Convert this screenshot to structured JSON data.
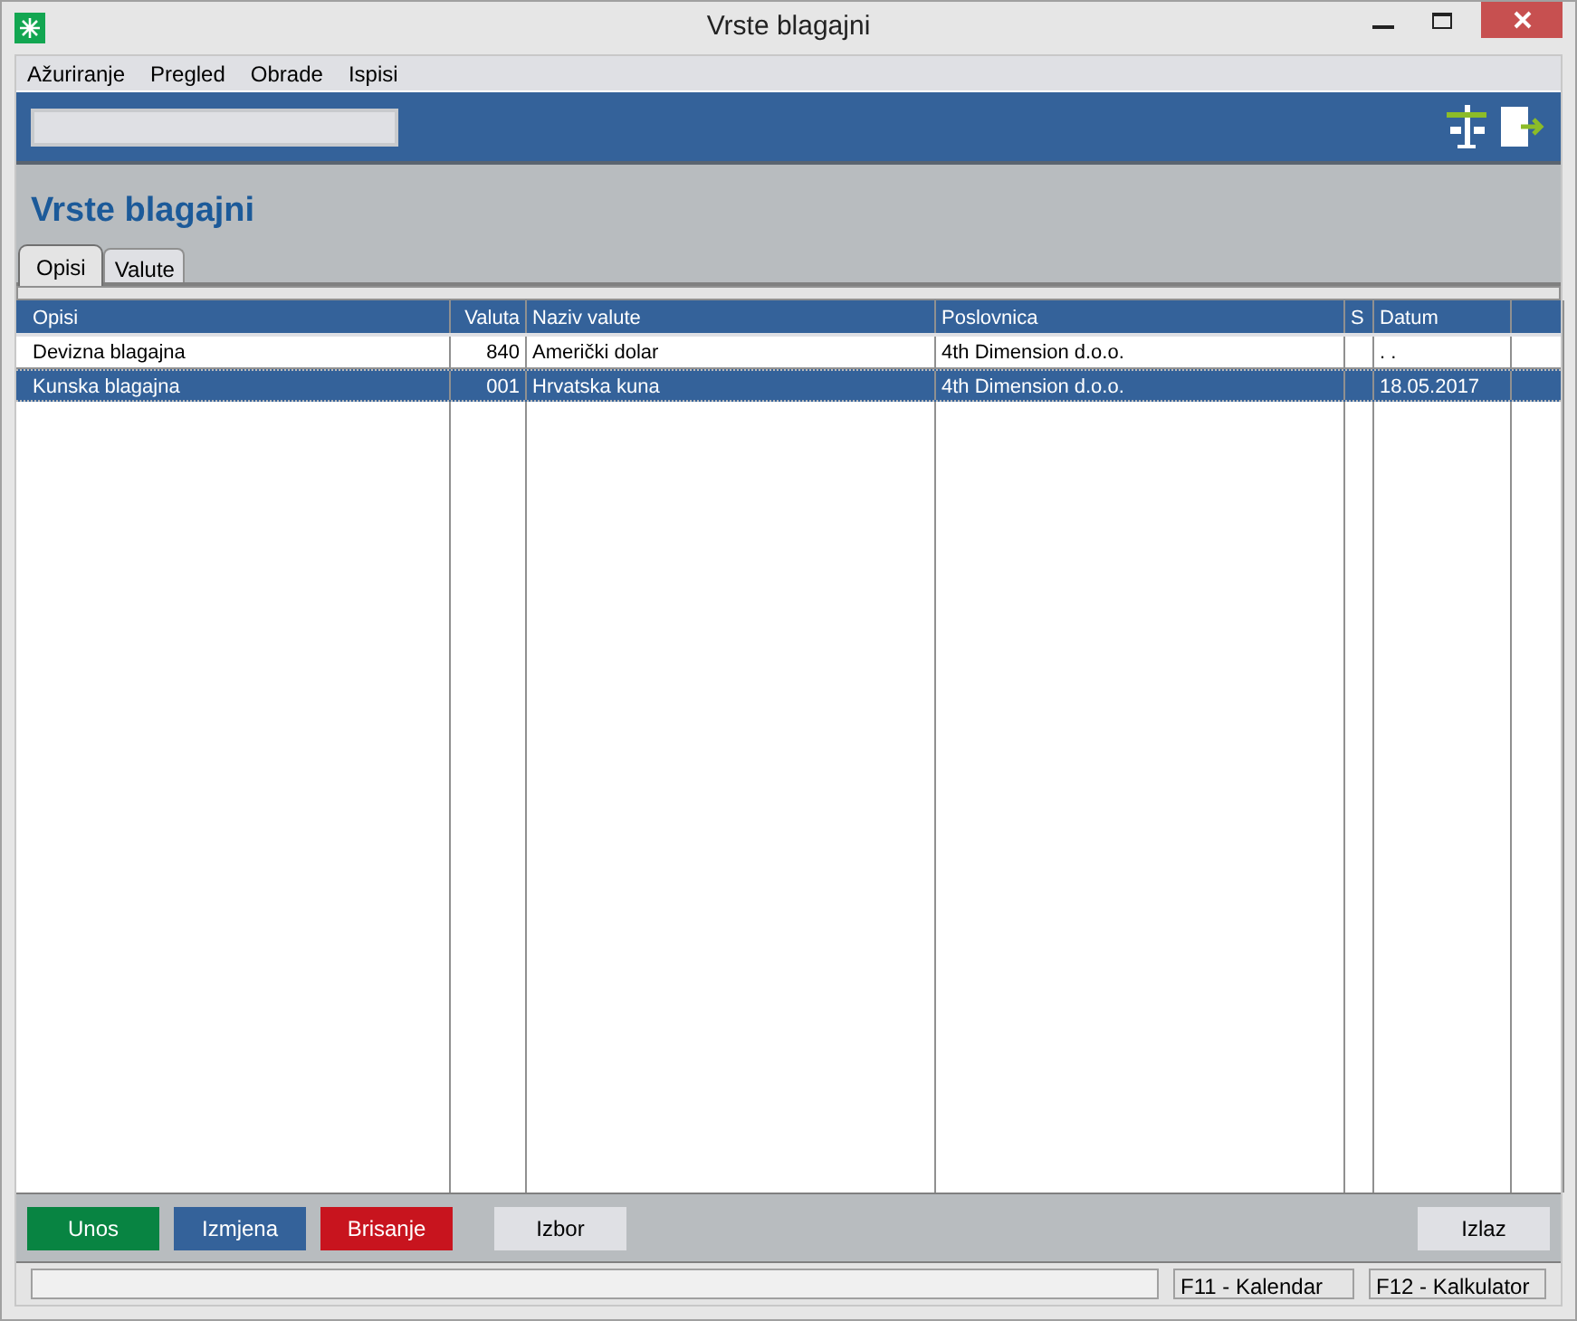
{
  "window": {
    "title": "Vrste blagajni"
  },
  "menu": [
    "Ažuriranje",
    "Pregled",
    "Obrade",
    "Ispisi"
  ],
  "heading": "Vrste blagajni",
  "tabs": [
    {
      "label": "Opisi",
      "selected": true
    },
    {
      "label": "Valute",
      "selected": false
    }
  ],
  "table": {
    "columns": [
      "Opisi",
      "Valuta",
      "Naziv valute",
      "Poslovnica",
      "S",
      "Datum"
    ],
    "rows": [
      {
        "cells": [
          "Devizna blagajna",
          "840",
          "Američki dolar",
          "4th Dimension d.o.o.",
          "",
          ". ."
        ],
        "selected": false
      },
      {
        "cells": [
          "Kunska blagajna",
          "001",
          "Hrvatska kuna",
          "4th Dimension d.o.o.",
          "",
          "18.05.2017"
        ],
        "selected": true
      }
    ]
  },
  "buttons": [
    {
      "label": "Unos",
      "kind": "green"
    },
    {
      "label": "Izmjena",
      "kind": "blue"
    },
    {
      "label": "Brisanje",
      "kind": "red"
    },
    {
      "label": "Izbor",
      "kind": "gray"
    },
    {
      "label": "Izlaz",
      "kind": "gray"
    }
  ],
  "status_bar": [
    "F11 - Kalendar",
    "F12 - Kalkulator"
  ]
}
